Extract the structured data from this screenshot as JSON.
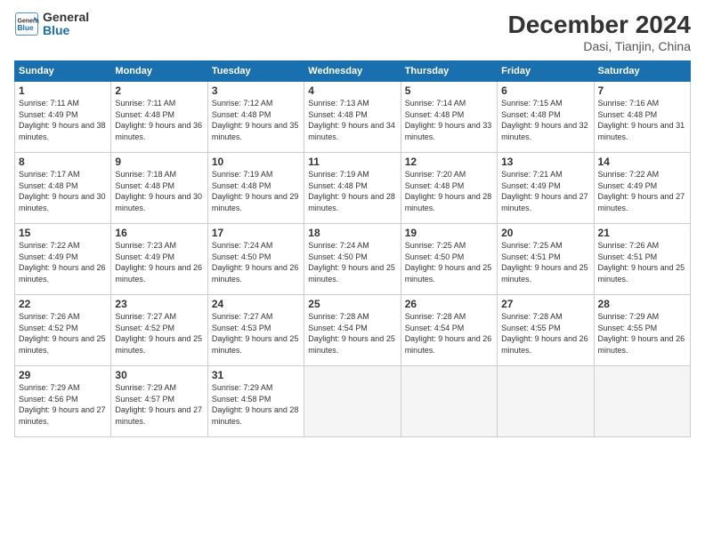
{
  "logo": {
    "line1": "General",
    "line2": "Blue"
  },
  "title": "December 2024",
  "location": "Dasi, Tianjin, China",
  "days_of_week": [
    "Sunday",
    "Monday",
    "Tuesday",
    "Wednesday",
    "Thursday",
    "Friday",
    "Saturday"
  ],
  "weeks": [
    [
      {
        "day": "1",
        "sunrise": "7:11 AM",
        "sunset": "4:49 PM",
        "daylight": "9 hours and 38 minutes."
      },
      {
        "day": "2",
        "sunrise": "7:11 AM",
        "sunset": "4:48 PM",
        "daylight": "9 hours and 36 minutes."
      },
      {
        "day": "3",
        "sunrise": "7:12 AM",
        "sunset": "4:48 PM",
        "daylight": "9 hours and 35 minutes."
      },
      {
        "day": "4",
        "sunrise": "7:13 AM",
        "sunset": "4:48 PM",
        "daylight": "9 hours and 34 minutes."
      },
      {
        "day": "5",
        "sunrise": "7:14 AM",
        "sunset": "4:48 PM",
        "daylight": "9 hours and 33 minutes."
      },
      {
        "day": "6",
        "sunrise": "7:15 AM",
        "sunset": "4:48 PM",
        "daylight": "9 hours and 32 minutes."
      },
      {
        "day": "7",
        "sunrise": "7:16 AM",
        "sunset": "4:48 PM",
        "daylight": "9 hours and 31 minutes."
      }
    ],
    [
      {
        "day": "8",
        "sunrise": "7:17 AM",
        "sunset": "4:48 PM",
        "daylight": "9 hours and 30 minutes."
      },
      {
        "day": "9",
        "sunrise": "7:18 AM",
        "sunset": "4:48 PM",
        "daylight": "9 hours and 30 minutes."
      },
      {
        "day": "10",
        "sunrise": "7:19 AM",
        "sunset": "4:48 PM",
        "daylight": "9 hours and 29 minutes."
      },
      {
        "day": "11",
        "sunrise": "7:19 AM",
        "sunset": "4:48 PM",
        "daylight": "9 hours and 28 minutes."
      },
      {
        "day": "12",
        "sunrise": "7:20 AM",
        "sunset": "4:48 PM",
        "daylight": "9 hours and 28 minutes."
      },
      {
        "day": "13",
        "sunrise": "7:21 AM",
        "sunset": "4:49 PM",
        "daylight": "9 hours and 27 minutes."
      },
      {
        "day": "14",
        "sunrise": "7:22 AM",
        "sunset": "4:49 PM",
        "daylight": "9 hours and 27 minutes."
      }
    ],
    [
      {
        "day": "15",
        "sunrise": "7:22 AM",
        "sunset": "4:49 PM",
        "daylight": "9 hours and 26 minutes."
      },
      {
        "day": "16",
        "sunrise": "7:23 AM",
        "sunset": "4:49 PM",
        "daylight": "9 hours and 26 minutes."
      },
      {
        "day": "17",
        "sunrise": "7:24 AM",
        "sunset": "4:50 PM",
        "daylight": "9 hours and 26 minutes."
      },
      {
        "day": "18",
        "sunrise": "7:24 AM",
        "sunset": "4:50 PM",
        "daylight": "9 hours and 25 minutes."
      },
      {
        "day": "19",
        "sunrise": "7:25 AM",
        "sunset": "4:50 PM",
        "daylight": "9 hours and 25 minutes."
      },
      {
        "day": "20",
        "sunrise": "7:25 AM",
        "sunset": "4:51 PM",
        "daylight": "9 hours and 25 minutes."
      },
      {
        "day": "21",
        "sunrise": "7:26 AM",
        "sunset": "4:51 PM",
        "daylight": "9 hours and 25 minutes."
      }
    ],
    [
      {
        "day": "22",
        "sunrise": "7:26 AM",
        "sunset": "4:52 PM",
        "daylight": "9 hours and 25 minutes."
      },
      {
        "day": "23",
        "sunrise": "7:27 AM",
        "sunset": "4:52 PM",
        "daylight": "9 hours and 25 minutes."
      },
      {
        "day": "24",
        "sunrise": "7:27 AM",
        "sunset": "4:53 PM",
        "daylight": "9 hours and 25 minutes."
      },
      {
        "day": "25",
        "sunrise": "7:28 AM",
        "sunset": "4:54 PM",
        "daylight": "9 hours and 25 minutes."
      },
      {
        "day": "26",
        "sunrise": "7:28 AM",
        "sunset": "4:54 PM",
        "daylight": "9 hours and 26 minutes."
      },
      {
        "day": "27",
        "sunrise": "7:28 AM",
        "sunset": "4:55 PM",
        "daylight": "9 hours and 26 minutes."
      },
      {
        "day": "28",
        "sunrise": "7:29 AM",
        "sunset": "4:55 PM",
        "daylight": "9 hours and 26 minutes."
      }
    ],
    [
      {
        "day": "29",
        "sunrise": "7:29 AM",
        "sunset": "4:56 PM",
        "daylight": "9 hours and 27 minutes."
      },
      {
        "day": "30",
        "sunrise": "7:29 AM",
        "sunset": "4:57 PM",
        "daylight": "9 hours and 27 minutes."
      },
      {
        "day": "31",
        "sunrise": "7:29 AM",
        "sunset": "4:58 PM",
        "daylight": "9 hours and 28 minutes."
      },
      null,
      null,
      null,
      null
    ]
  ]
}
